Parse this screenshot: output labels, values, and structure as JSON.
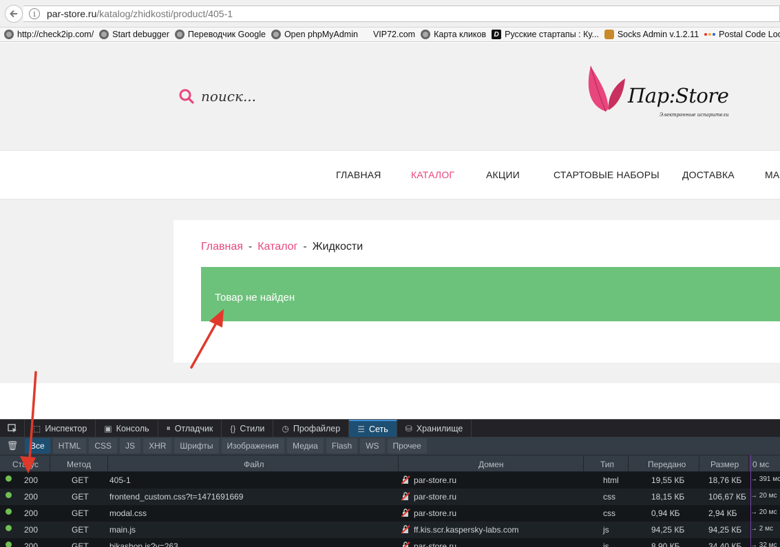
{
  "browser": {
    "url_host": "par-store.ru",
    "url_path": "/katalog/zhidkosti/product/405-1",
    "bookmarks": [
      {
        "label": "http://check2ip.com/",
        "icon": "globe-icon"
      },
      {
        "label": "Start debugger",
        "icon": "globe-icon"
      },
      {
        "label": "Переводчик Google",
        "icon": "globe-icon"
      },
      {
        "label": "Open phpMyAdmin",
        "icon": "globe-icon"
      },
      {
        "label": "VIP72.com",
        "icon": "none"
      },
      {
        "label": "Карта кликов",
        "icon": "globe-icon"
      },
      {
        "label": "Русские стартапы : Ку...",
        "icon": "d-icon"
      },
      {
        "label": "Socks Admin v.1.2.11",
        "icon": "squirrel-icon"
      },
      {
        "label": "Postal Code Lookup",
        "icon": "dots-icon"
      }
    ]
  },
  "site": {
    "search_placeholder": "поиск...",
    "logo_title": "Пар:Store",
    "logo_subtitle": "Электронные испарители",
    "accent_color": "#e8467c",
    "nav": [
      {
        "label": "ГЛАВНАЯ",
        "active": false
      },
      {
        "label": "КАТАЛОГ",
        "active": true
      },
      {
        "label": "АКЦИИ",
        "active": false
      },
      {
        "label": "СТАРТОВЫЕ НАБОРЫ",
        "active": false
      },
      {
        "label": "ДОСТАВКА",
        "active": false
      },
      {
        "label": "МА",
        "active": false
      }
    ],
    "breadcrumb": {
      "home": "Главная",
      "sep": "-",
      "catalog": "Каталог",
      "current": "Жидкости"
    },
    "alert_text": "Товар не найден",
    "alert_color": "#6dc27b"
  },
  "devtools": {
    "tabs": [
      {
        "label": "Инспектор",
        "icon": "inspector-icon",
        "glyph": "⬚"
      },
      {
        "label": "Консоль",
        "icon": "console-icon",
        "glyph": "▣"
      },
      {
        "label": "Отладчик",
        "icon": "debugger-icon",
        "glyph": "⏸"
      },
      {
        "label": "Стили",
        "icon": "style-editor-icon",
        "glyph": "{}"
      },
      {
        "label": "Профайлер",
        "icon": "profiler-icon",
        "glyph": "◷"
      },
      {
        "label": "Сеть",
        "icon": "network-icon",
        "glyph": "☰",
        "active": true
      },
      {
        "label": "Хранилище",
        "icon": "storage-icon",
        "glyph": "⛁"
      }
    ],
    "filters": [
      "Все",
      "HTML",
      "CSS",
      "JS",
      "XHR",
      "Шрифты",
      "Изображения",
      "Медиа",
      "Flash",
      "WS",
      "Прочее"
    ],
    "columns": {
      "status": "Статус",
      "method": "Метод",
      "file": "Файл",
      "domain": "Домен",
      "type": "Тип",
      "transferred": "Передано",
      "size": "Размер",
      "timeline": "0 мс"
    },
    "requests": [
      {
        "status": "200",
        "method": "GET",
        "file": "405-1",
        "domain": "par-store.ru",
        "type": "html",
        "transferred": "19,55 КБ",
        "size": "18,76 КБ",
        "time": "→ 391 мс"
      },
      {
        "status": "200",
        "method": "GET",
        "file": "frontend_custom.css?t=1471691669",
        "domain": "par-store.ru",
        "type": "css",
        "transferred": "18,15 КБ",
        "size": "106,67 КБ",
        "time": "→ 20 мс"
      },
      {
        "status": "200",
        "method": "GET",
        "file": "modal.css",
        "domain": "par-store.ru",
        "type": "css",
        "transferred": "0,94 КБ",
        "size": "2,94 КБ",
        "time": "→ 20 мс"
      },
      {
        "status": "200",
        "method": "GET",
        "file": "main.js",
        "domain": "ff.kis.scr.kaspersky-labs.com",
        "type": "js",
        "transferred": "94,25 КБ",
        "size": "94,25 КБ",
        "time": "→ 2 мс"
      },
      {
        "status": "200",
        "method": "GET",
        "file": "bikashop.js?v=263",
        "domain": "par-store.ru",
        "type": "js",
        "transferred": "8,90 КБ",
        "size": "34,40 КБ",
        "time": "→ 32 мс"
      }
    ]
  },
  "annotation_color": "#e0392b"
}
